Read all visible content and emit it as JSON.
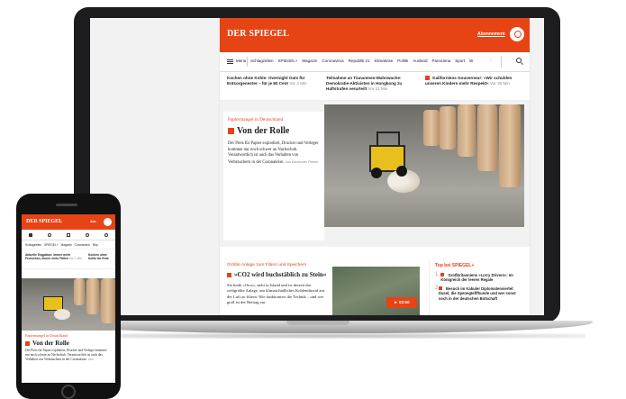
{
  "brand": {
    "logo": "DER SPIEGEL",
    "accent": "#e64415",
    "abo_label": "Abonnement"
  },
  "nav": {
    "menu_label": "Menü",
    "items": [
      "Schlagzeilen",
      "SPIEGEL+",
      "Magazin",
      "Coronavirus",
      "Republik 21",
      "Klimakrise",
      "Politik",
      "Ausland",
      "Panorama",
      "Sport",
      "W"
    ],
    "more": "›"
  },
  "ticker": [
    {
      "text": "Kochen ohne Kohle: Overnight Oats für Entsorgenester – für je 80 Cent",
      "time": "Vor 2 Min"
    },
    {
      "text": "Teilnahme an Tiananmen-Mahnwache: Demokratie-Aktivisten in Hongkong zu Haftstrafen verurteilt",
      "time": "Vor 21 Min"
    },
    {
      "text": "Kaliforniens Gouverneur: »Wir schulden unseren Kindern mehr Respekt«",
      "time": "Vor 36 Min"
    }
  ],
  "hero": {
    "kicker": "Papiermangel in Deutschland",
    "title": "Von der Rolle",
    "text": "Der Preis für Papier explodiert, Drucker und Verleger kommen nur noch schwer an Nachschub. Verantwortlich ist auch das Verhalten von Verbrauchern in der Coronakrise.",
    "author": "Von Alexander Preker"
  },
  "story": {
    "kicker": "Größte Anlage zum Filtern und Speichern",
    "title": "»CO2 wird buchstäblich zu Stein«",
    "text": "Sie heißt »Orca«, steht in Island und ist derzeit die weltgrößte Anlage, um klimaschädliches Kohlendioxid aus der Luft zu filtern. Wie funktioniert die Technik – und wie groß ist der Beitrag zur",
    "video_duration": "03:50"
  },
  "sidebar": {
    "title": "Top bei SPIEGEL+",
    "items": [
      {
        "num": "1",
        "text": "Großbritanniens »Lorry Drivers«: Im Königreich der leeren Regale"
      },
      {
        "num": "2",
        "text": "Besuch im Kabuler Diplomatenviertel: Dusel, die Spenegtelffhunde und wer sonst noch in der deutschen Botschaft"
      }
    ]
  },
  "mobile": {
    "logo": "DER SPIEGEL",
    "abo_label": "Abo",
    "nav_items": [
      "Schlagzeilen",
      "SPIEGEL+",
      "Magazin",
      "Coronavirus",
      "Rep"
    ],
    "ticker": [
      {
        "text": "Aktuelle Engpässe: Immer mehr Fernsehen, immer mehr Fällen",
        "time": "Vor 1 Min"
      },
      {
        "text": "Kochen ohne Kohle für Ents",
        "time": ""
      }
    ],
    "kicker": "Papiermangel in Deutschland",
    "title": "Von der Rolle",
    "text": "Der Preis für Papier explodiert, Drucker und Verleger kommen nur noch schwer an Nachschub. Verantwortlich ist auch das Verhalten von Verbrauchern in der Coronakrise.",
    "author": "Von"
  }
}
